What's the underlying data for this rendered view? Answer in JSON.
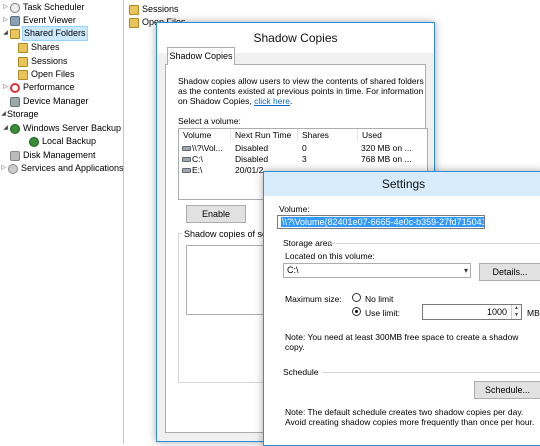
{
  "tree": {
    "items": [
      {
        "label": "Task Scheduler",
        "icon": "clock-icon"
      },
      {
        "label": "Event Viewer",
        "icon": "event-viewer-icon"
      },
      {
        "label": "Shared Folders",
        "icon": "shared-folders-icon"
      },
      {
        "label": "Shares",
        "icon": "shares-icon"
      },
      {
        "label": "Sessions",
        "icon": "sessions-icon"
      },
      {
        "label": "Open Files",
        "icon": "open-files-icon"
      },
      {
        "label": "Performance",
        "icon": "performance-icon"
      },
      {
        "label": "Device Manager",
        "icon": "device-manager-icon"
      },
      {
        "label": "Storage",
        "icon": "storage-icon"
      },
      {
        "label": "Windows Server Backup",
        "icon": "backup-icon"
      },
      {
        "label": "Local Backup",
        "icon": "local-backup-icon"
      },
      {
        "label": "Disk Management",
        "icon": "disk-icon"
      },
      {
        "label": "Services and Applications",
        "icon": "services-icon"
      }
    ]
  },
  "main": {
    "items": [
      {
        "label": "Sessions"
      },
      {
        "label": "Open Files"
      }
    ]
  },
  "shadow": {
    "title": "Shadow Copies",
    "tab": "Shadow Copies",
    "description": "Shadow copies allow users to view the contents of shared folders as the contents existed at previous points in time. For information on Shadow Copies,",
    "link": "click here",
    "select_label": "Select a volume:",
    "columns": [
      "Volume",
      "Next Run Time",
      "Shares",
      "Used"
    ],
    "rows": [
      {
        "volume": "\\\\?\\Vol...",
        "next_run": "Disabled",
        "shares": "0",
        "used": "320 MB on ..."
      },
      {
        "volume": "C:\\",
        "next_run": "Disabled",
        "shares": "3",
        "used": "768 MB on ..."
      },
      {
        "volume": "E:\\",
        "next_run": "20/01/2",
        "shares": "",
        "used": ""
      }
    ],
    "enable_button": "Enable",
    "copies_label": "Shadow copies of sele"
  },
  "settings": {
    "title": "Settings",
    "volume_label": "Volume:",
    "volume_value": "\\\\?\\Volume{82401e07-6665-4e0c-b359-27fd715041ad}\\",
    "storage_area": "Storage area",
    "located_label": "Located on this volume:",
    "located_value": "C:\\",
    "details_button": "Details...",
    "max_size_label": "Maximum size:",
    "no_limit": "No limit",
    "use_limit": "Use limit:",
    "limit_value": "1000",
    "unit": "MB",
    "note_min": "Note: You need at least 300MB free space to create a shadow copy.",
    "schedule_label": "Schedule",
    "schedule_button": "Schedule...",
    "schedule_note": "Note: The default schedule creates two shadow copies per day. Avoid creating shadow copies more frequently than once per hour."
  }
}
